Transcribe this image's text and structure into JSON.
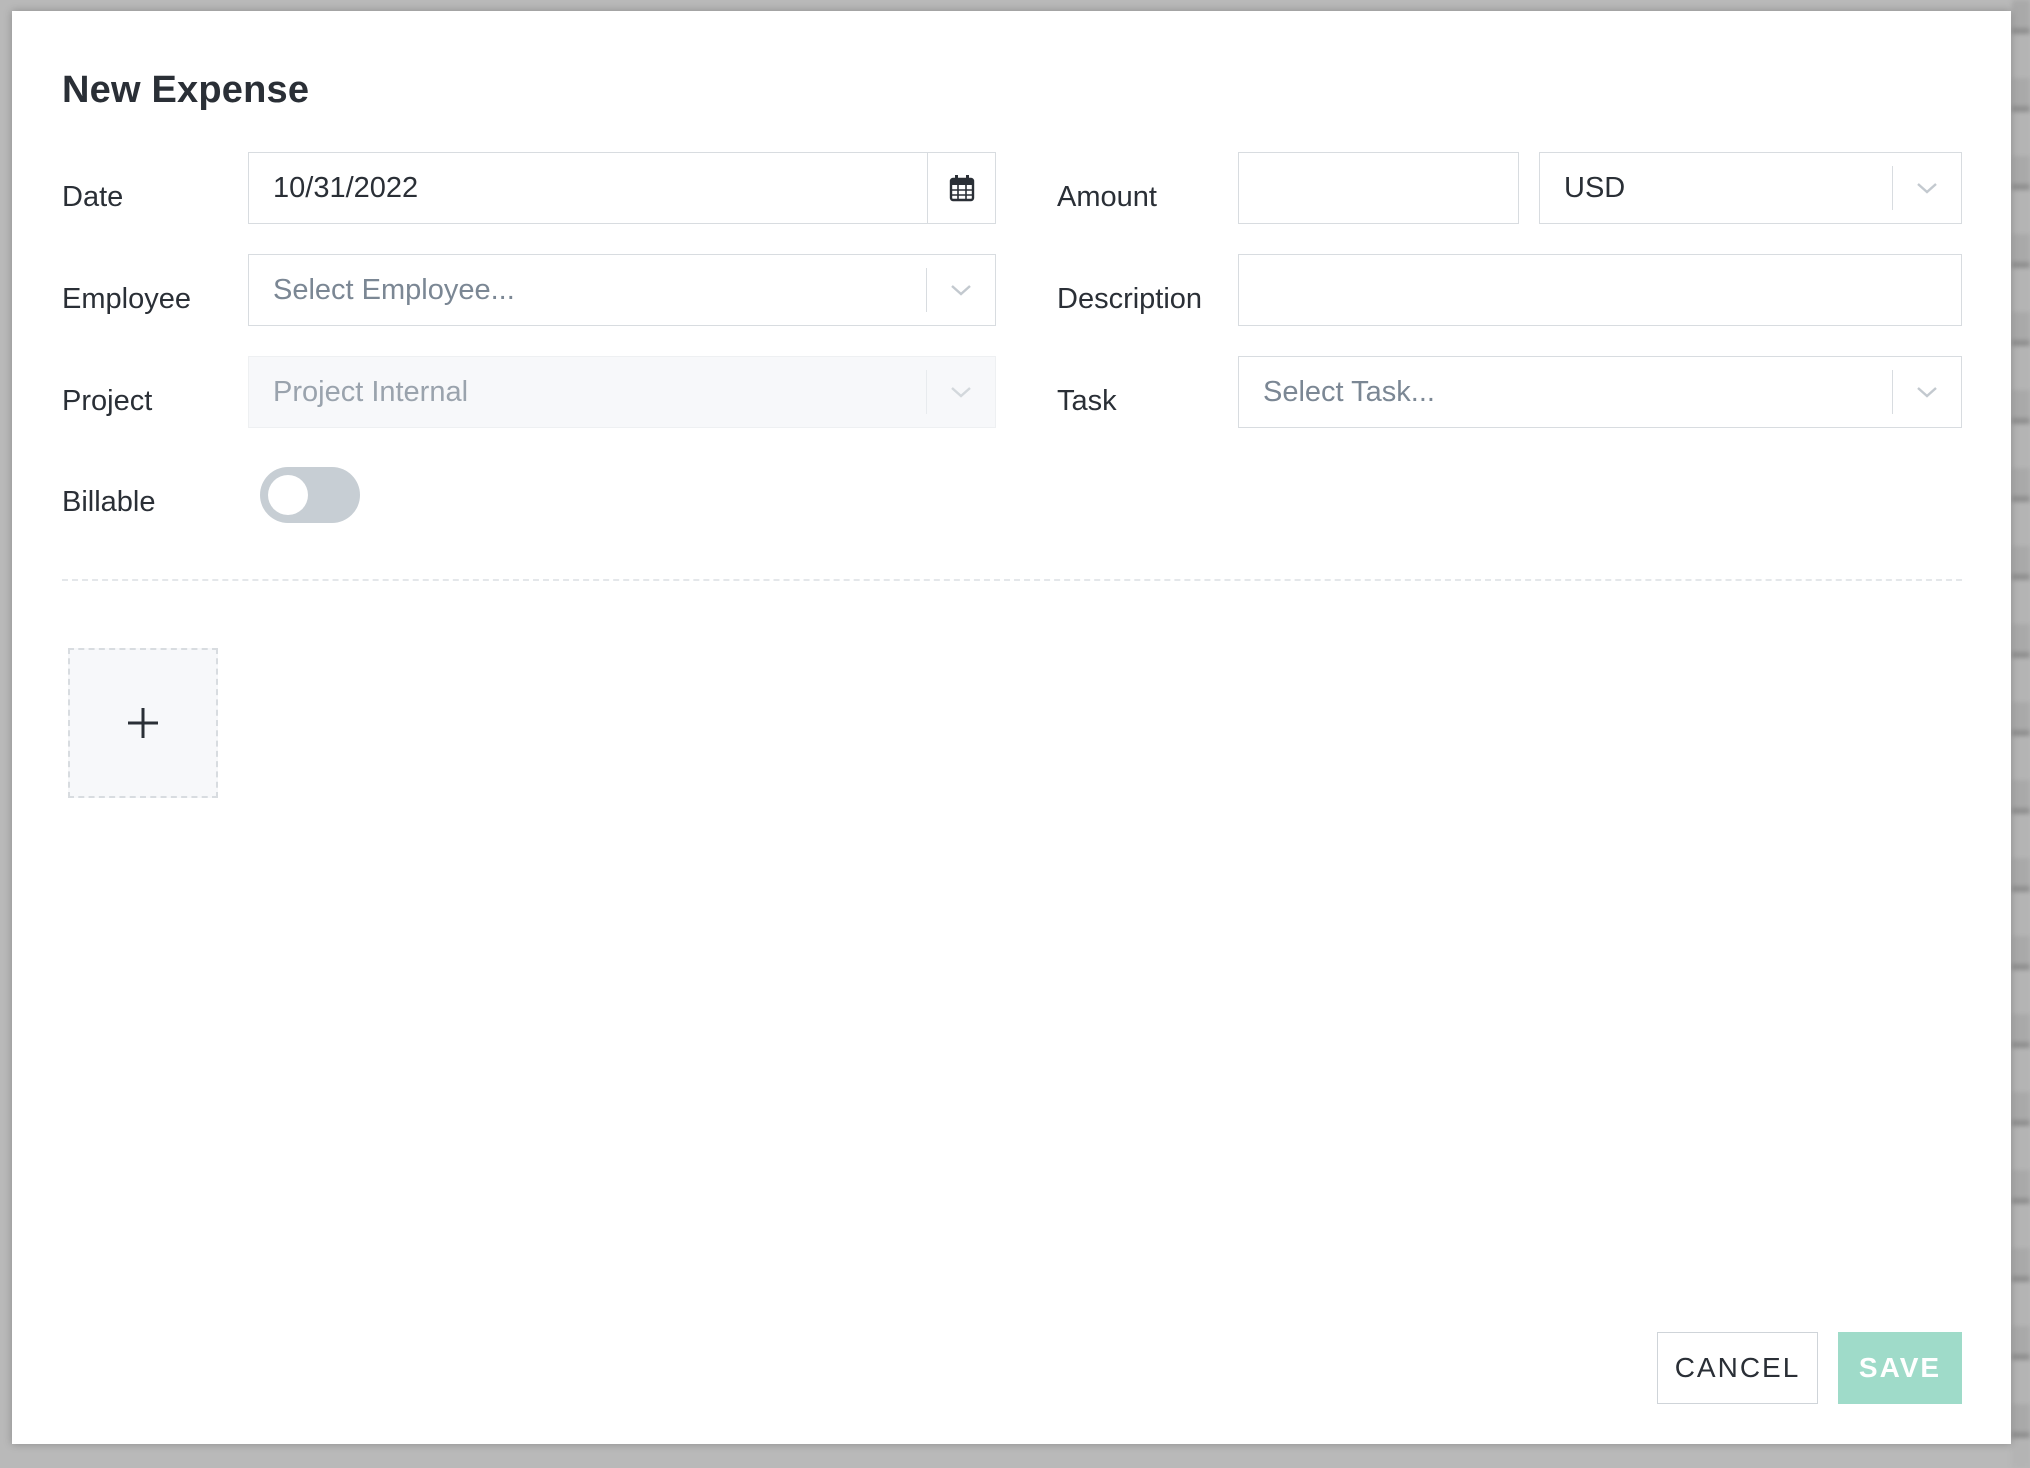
{
  "dialog": {
    "title": "New Expense"
  },
  "form": {
    "date": {
      "label": "Date",
      "value": "10/31/2022"
    },
    "amount": {
      "label": "Amount",
      "value": ""
    },
    "currency": {
      "value": "USD"
    },
    "employee": {
      "label": "Employee",
      "placeholder": "Select Employee..."
    },
    "description": {
      "label": "Description",
      "value": ""
    },
    "project": {
      "label": "Project",
      "value": "Project Internal"
    },
    "task": {
      "label": "Task",
      "placeholder": "Select Task..."
    },
    "billable": {
      "label": "Billable",
      "on": false
    }
  },
  "actions": {
    "cancel_label": "CANCEL",
    "save_label": "SAVE"
  },
  "colors": {
    "save_button": "#9fdbc9",
    "toggle_off": "#c7ced4"
  },
  "icons": {
    "date": "calendar-icon",
    "dropdown": "chevron-down-icon",
    "upload": "plus-icon"
  }
}
